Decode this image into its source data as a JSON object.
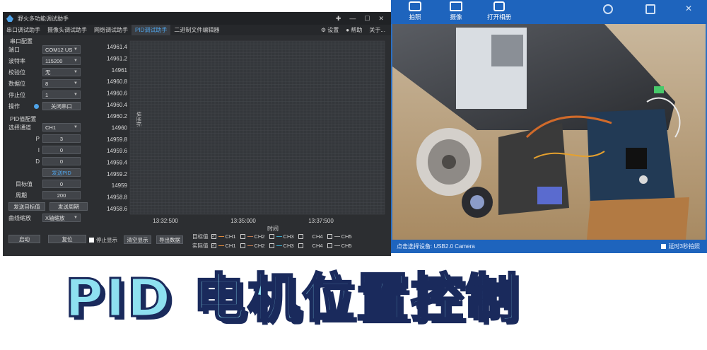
{
  "app": {
    "title": "野火多功能调试助手",
    "window_controls": [
      "✚",
      "—",
      "☐",
      "✕"
    ],
    "tabs": [
      "串口调试助手",
      "摄像头调试助手",
      "网络调试助手",
      "PID调试助手",
      "二进制文件编辑器"
    ],
    "active_tab": 3,
    "settings_label": "⚙ 设置",
    "help_label": "● 帮助",
    "about_label": "关于..."
  },
  "serial_config": {
    "title": "串口配置",
    "port_label": "端口",
    "port_value": "COM12 US",
    "baud_label": "波特率",
    "baud_value": "115200",
    "parity_label": "校验位",
    "parity_value": "无",
    "databits_label": "数据位",
    "databits_value": "8",
    "stopbits_label": "停止位",
    "stopbits_value": "1",
    "op_label": "操作",
    "close_port_button": "关闭串口"
  },
  "pid_config": {
    "title": "PID值配置",
    "channel_label": "选择通道",
    "channel_value": "CH1",
    "p_label": "P",
    "p_value": "3",
    "i_label": "I",
    "i_value": "0",
    "d_label": "D",
    "d_value": "0",
    "send_pid_button": "发送PID",
    "target_label": "目标值",
    "target_value": "0",
    "period_label": "周期",
    "period_value": "200",
    "send_target_button": "发送目标值",
    "send_period_button": "发送周期",
    "scale_label": "曲线缩放",
    "scale_value": "X轴缩放"
  },
  "bottom": {
    "start_button": "启动",
    "reset_button": "复位",
    "stop_display_label": "停止显示",
    "clear_display_button": "清空显示",
    "export_button": "导出数据",
    "target_row_label": "目标值",
    "actual_row_label": "实际值",
    "channels": [
      "CH1",
      "CH2",
      "CH3",
      "CH4",
      "CH5"
    ]
  },
  "chart_data": {
    "type": "line",
    "ylabel": "纵坐标",
    "xlabel": "时间",
    "y_ticks": [
      "14961.4",
      "14961.2",
      "14961",
      "14960.8",
      "14960.6",
      "14960.4",
      "14960.2",
      "14960",
      "14959.8",
      "14959.6",
      "14959.4",
      "14959.2",
      "14959",
      "14958.8",
      "14958.6"
    ],
    "x_ticks": [
      "13:32:500",
      "13:35:000",
      "13:37:500"
    ],
    "ylim": [
      14958.5,
      14961.5
    ],
    "grid": true,
    "series": [],
    "colors": {
      "background": "#34373b",
      "grid": "#45484d"
    }
  },
  "camera": {
    "tools": [
      {
        "label": "拍照",
        "icon": "camera-icon"
      },
      {
        "label": "摄像",
        "icon": "video-icon"
      },
      {
        "label": "打开相册",
        "icon": "album-icon"
      }
    ],
    "status_text": "点击选择设备: USB2.0 Camera",
    "delay_label": "延时3秒拍照"
  },
  "caption": {
    "text": "PID 电机位置控制"
  },
  "colors": {
    "accent": "#4fa3e8",
    "camera_blue": "#1e64bd",
    "caption_fill": "#8ee0f0",
    "caption_stroke": "#1a2a5c"
  }
}
